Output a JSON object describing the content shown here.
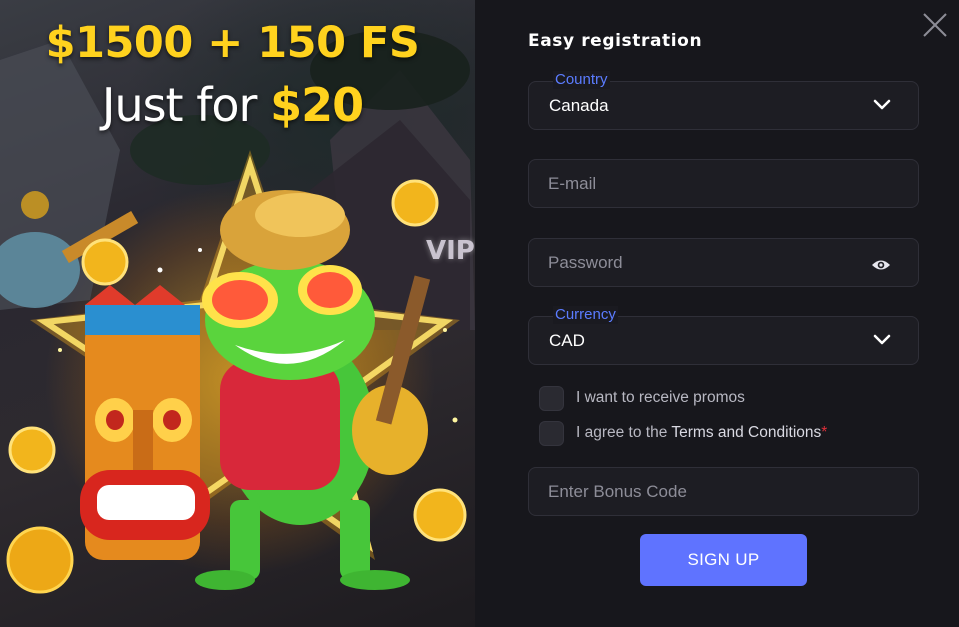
{
  "promo": {
    "headline": "$1500 + 150 FS",
    "sub_prefix": "Just for ",
    "sub_amount": "$20",
    "vip_sign": "VIP"
  },
  "form": {
    "title": "Easy registration",
    "country": {
      "label": "Country",
      "value": "Canada",
      "icon": "chevron-down-icon"
    },
    "email": {
      "placeholder": "E-mail"
    },
    "password": {
      "placeholder": "Password",
      "icon": "eye-icon"
    },
    "currency": {
      "label": "Currency",
      "value": "CAD",
      "icon": "chevron-down-icon"
    },
    "promos_checkbox": {
      "label": "I want to receive promos",
      "checked": false
    },
    "terms_checkbox": {
      "label_prefix": "I agree to the ",
      "link": "Terms and Conditions",
      "required_mark": "*",
      "checked": false
    },
    "bonus_code": {
      "placeholder": "Enter Bonus Code"
    },
    "submit_label": "SIGN UP"
  },
  "close_icon": "close-icon",
  "colors": {
    "accent": "#5f73ff",
    "label_accent": "#5b7cff",
    "gold": "#ffd21e",
    "panel_bg": "#17171c",
    "required": "#e0303a"
  }
}
